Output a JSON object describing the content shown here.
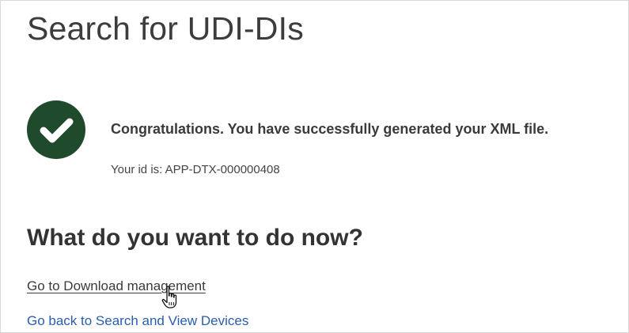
{
  "page": {
    "title": "Search for UDI-DIs"
  },
  "result": {
    "status_icon": "check-circle-icon",
    "icon_color": "#1f4a2b",
    "message": "Congratulations. You have successfully generated your XML file.",
    "id_line": "Your id is: APP-DTX-000000408"
  },
  "next_steps": {
    "heading": "What do you want to do now?",
    "links": [
      {
        "label": "Go to Download management"
      },
      {
        "label": "Go back to Search and View Devices"
      }
    ],
    "link_color": "#2a5db0"
  },
  "cursor": {
    "icon": "hand-pointer-icon"
  }
}
